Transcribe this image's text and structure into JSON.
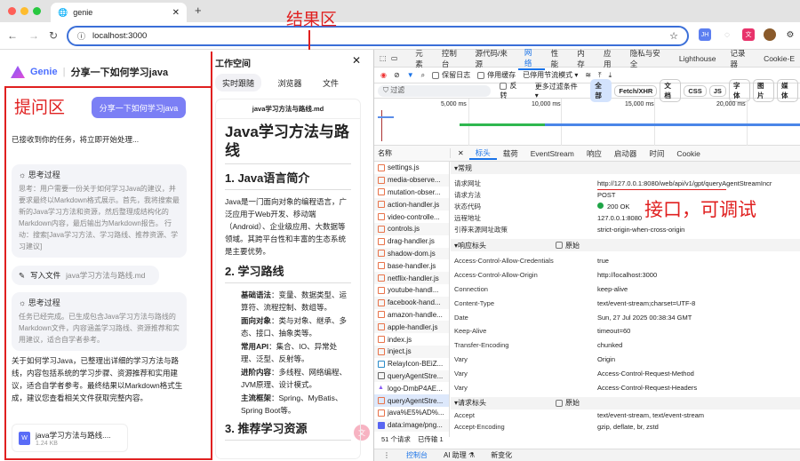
{
  "browser": {
    "tab_title": "genie",
    "url": "localhost:3000",
    "extensions": [
      "JH",
      "chat",
      "translate",
      "cookie",
      "extension"
    ]
  },
  "annotations": {
    "result_area": "结果区",
    "question_area": "提问区",
    "api_note": "接口，可调试"
  },
  "app": {
    "brand": "Genie",
    "title": "分享一下如何学习java",
    "user_message": "分享一下如何学习java",
    "ack": "已接收到你的任务，将立即开始处理...",
    "think1": {
      "title": "思考过程",
      "text": "思考：用户需要一份关于如何学习Java的建议，并要求最终以Markdown格式展示。首先，我将搜索最新的Java学习方法和资源，然后整理成结构化的Markdown内容，最后输出为Markdown报告。 行动：搜索[Java学习方法、学习路线、推荐资源、学习建议]"
    },
    "write_file": {
      "label": "写入文件",
      "file": "java学习方法与路线.md"
    },
    "think2": {
      "title": "思考过程",
      "text": "任务已经完成。已生成包含Java学习方法与路线的Markdown文件，内容涵盖学习路线、资源推荐和实用建议，适合自学者参考。"
    },
    "final": "关于如何学习Java，已整理出详细的学习方法与路线，内容包括系统的学习步骤、资源推荐和实用建议，适合自学者参考。最终结果以Markdown格式生成，建议您查看相关文件获取完整内容。",
    "attachment": {
      "name": "java学习方法与路线....",
      "size": "1.24 KB"
    }
  },
  "workspace": {
    "title": "工作空间",
    "tabs": [
      "实时跟随",
      "浏览器",
      "文件"
    ],
    "doc_name": "java学习方法与路线.md",
    "h1": "Java学习方法与路线",
    "h2_1": "1. Java语言简介",
    "intro": "Java是一门面向对象的编程语言，广泛应用于Web开发、移动端（Android）、企业级应用、大数据等领域。其跨平台性和丰富的生态系统是主要优势。",
    "h2_2": "2. 学习路线",
    "items": [
      {
        "k": "基础语法",
        "v": "：变量、数据类型、运算符、流程控制、数组等。"
      },
      {
        "k": "面向对象",
        "v": "：类与对象、继承、多态、接口、抽象类等。"
      },
      {
        "k": "常用API",
        "v": "：集合、IO、异常处理、泛型、反射等。"
      },
      {
        "k": "进阶内容",
        "v": "：多线程、网络编程、JVM原理、设计模式。"
      },
      {
        "k": "主流框架",
        "v": "：Spring、MyBatis、Spring Boot等。"
      }
    ],
    "h2_3": "3. 推荐学习资源"
  },
  "devtools": {
    "tabs": [
      "元素",
      "控制台",
      "源代码/来源",
      "网络",
      "性能",
      "内存",
      "应用",
      "隐私与安全",
      "Lighthouse",
      "记录器",
      "Cookie-E"
    ],
    "active_tab": "网络",
    "preserve_log": "保留日志",
    "disable_cache": "停用缓存",
    "throttle": "已停用节流模式",
    "filter_placeholder": "过滤",
    "invert": "反转",
    "more_filters": "更多过滤条件",
    "type_filters": [
      "全部",
      "Fetch/XHR",
      "文档",
      "CSS",
      "JS",
      "字体",
      "图片",
      "媒体"
    ],
    "timeline_ticks": [
      "5,000 ms",
      "10,000 ms",
      "15,000 ms",
      "20,000 ms"
    ],
    "name_header": "名称",
    "detail_tabs": [
      "标头",
      "载荷",
      "EventStream",
      "响应",
      "启动器",
      "时间",
      "Cookie"
    ],
    "requests": [
      "settings.js",
      "media-observe...",
      "mutation-obser...",
      "action-handler.js",
      "video-controlle...",
      "controls.js",
      "drag-handler.js",
      "shadow-dom.js",
      "base-handler.js",
      "netflix-handler.js",
      "youtube-handl...",
      "facebook-hand...",
      "amazon-handle...",
      "apple-handler.js",
      "index.js",
      "inject.js",
      "RelayIcon-BEiZ...",
      "queryAgentStre...",
      "logo-DmbP4AE...",
      "queryAgentStre...",
      "java%E5%AD%...",
      "data:image/png..."
    ],
    "status_bar": {
      "count": "51 个请求",
      "transferred": "已传输 1"
    },
    "general_title": "常规",
    "general": [
      {
        "k": "请求网址",
        "v": "http://127.0.0.1:8080/web/api/v1/gpt/queryAgentStreamIncr"
      },
      {
        "k": "请求方法",
        "v": "POST"
      },
      {
        "k": "状态代码",
        "v": "200 OK"
      },
      {
        "k": "远程地址",
        "v": "127.0.0.1:8080"
      },
      {
        "k": "引荐来源网址政策",
        "v": "strict-origin-when-cross-origin"
      }
    ],
    "response_title": "响应标头",
    "raw": "原始",
    "response": [
      {
        "k": "Access-Control-Allow-Credentials",
        "v": "true"
      },
      {
        "k": "Access-Control-Allow-Origin",
        "v": "http://localhost:3000"
      },
      {
        "k": "Connection",
        "v": "keep-alive"
      },
      {
        "k": "Content-Type",
        "v": "text/event-stream;charset=UTF-8"
      },
      {
        "k": "Date",
        "v": "Sun, 27 Jul 2025 00:38:34 GMT"
      },
      {
        "k": "Keep-Alive",
        "v": "timeout=60"
      },
      {
        "k": "Transfer-Encoding",
        "v": "chunked"
      },
      {
        "k": "Vary",
        "v": "Origin"
      },
      {
        "k": "Vary",
        "v": "Access-Control-Request-Method"
      },
      {
        "k": "Vary",
        "v": "Access-Control-Request-Headers"
      }
    ],
    "request_title": "请求标头",
    "request": [
      {
        "k": "Accept",
        "v": "text/event-stream, text/event-stream"
      },
      {
        "k": "Accept-Encoding",
        "v": "gzip, deflate, br, zstd"
      }
    ],
    "drawer_tabs": [
      "控制台",
      "AI 助理 ⚗",
      "新变化"
    ]
  }
}
